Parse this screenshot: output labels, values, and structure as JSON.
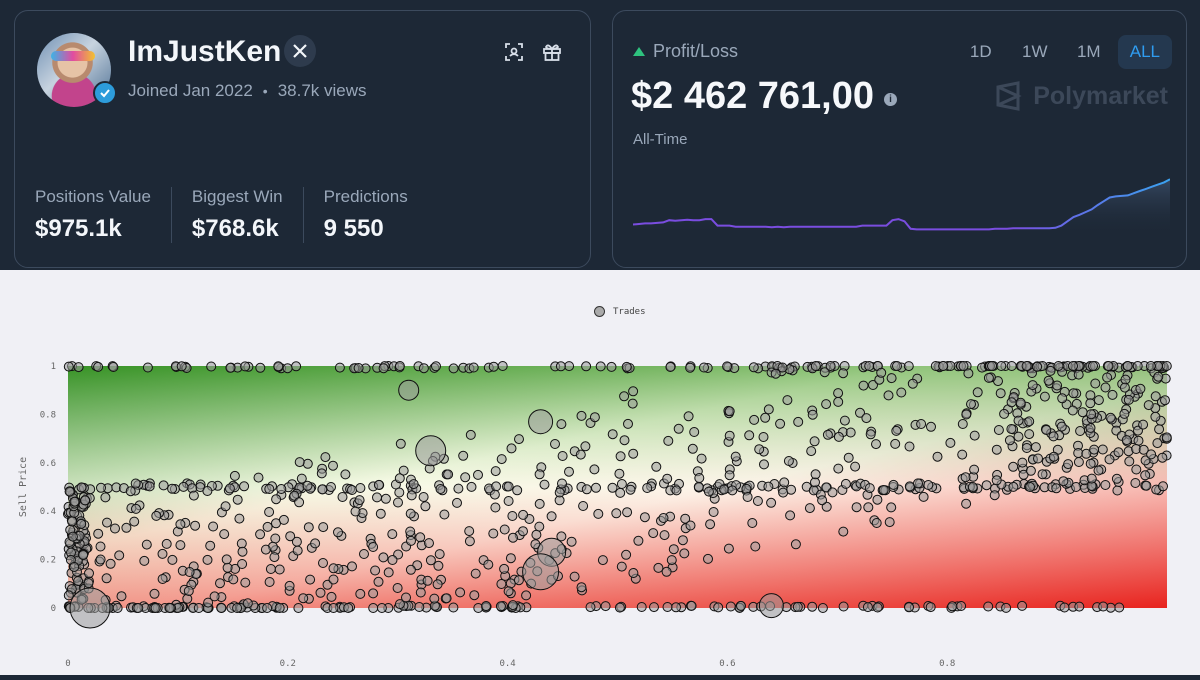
{
  "profile": {
    "username": "ImJustKen",
    "joined": "Joined Jan 2022",
    "views": "38.7k views",
    "stats": [
      {
        "label": "Positions Value",
        "value": "$975.1k"
      },
      {
        "label": "Biggest Win",
        "value": "$768.6k"
      },
      {
        "label": "Predictions",
        "value": "9 550"
      }
    ]
  },
  "pnl": {
    "label": "Profit/Loss",
    "value": "$2 462 761,00",
    "period": "All-Time",
    "brand": "Polymarket",
    "ranges": [
      "1D",
      "1W",
      "1M",
      "ALL"
    ],
    "active_range": "ALL",
    "trend": [
      0.12,
      0.13,
      0.14,
      0.14,
      0.15,
      0.16,
      0.2,
      0.19,
      0.2,
      0.21,
      0.2,
      0.2,
      0.22,
      0.22,
      0.1,
      0.1,
      0.1,
      0.08,
      0.08,
      0.08,
      0.08,
      0.08,
      0.08,
      0.07,
      0.08,
      0.07,
      0.08,
      0.08,
      0.08,
      0.08,
      0.08,
      0.08,
      0.08,
      0.08,
      0.08,
      0.08,
      0.08,
      0.08,
      0.1,
      0.1,
      0.1,
      0.1,
      0.1,
      0.2,
      0.22,
      0.18,
      0.04,
      0.03,
      0.03,
      0.03,
      0.03,
      0.03,
      0.03,
      0.03,
      0.03,
      0.03,
      0.03,
      0.03,
      0.03,
      0.03,
      0.04,
      0.04,
      0.04,
      0.05,
      0.05,
      0.05,
      0.05,
      0.05,
      0.05,
      0.05,
      0.06,
      0.1,
      0.18,
      0.26,
      0.3,
      0.35,
      0.4,
      0.48,
      0.55,
      0.62,
      0.64,
      0.65,
      0.66,
      0.7,
      0.74,
      0.78,
      0.82,
      0.86,
      0.9,
      0.96
    ]
  },
  "colors": {
    "accent": "#2f9cf0",
    "up": "#2ec27e",
    "line_start": "#7a4de0",
    "line_end": "#3aa2f0",
    "green_zone": "#2f8a1f",
    "red_zone": "#e8231e"
  },
  "chart_data": {
    "type": "scatter",
    "legend": [
      "Trades"
    ],
    "ylabel": "Sell Price",
    "xlim": [
      0,
      1
    ],
    "ylim": [
      0,
      1
    ],
    "xticks": [
      "0",
      "0.2",
      "0.4",
      "0.6",
      "0.8"
    ],
    "yticks": [
      "0",
      "0.2",
      "0.4",
      "0.6",
      "0.8",
      "1"
    ],
    "large_points": [
      {
        "x": 0.31,
        "y": 0.9
      },
      {
        "x": 0.33,
        "y": 0.65
      },
      {
        "x": 0.43,
        "y": 0.77
      },
      {
        "x": 0.44,
        "y": 0.23
      },
      {
        "x": 0.43,
        "y": 0.15
      },
      {
        "x": 0.64,
        "y": 0.01
      },
      {
        "x": 0.02,
        "y": 0.0
      }
    ]
  }
}
